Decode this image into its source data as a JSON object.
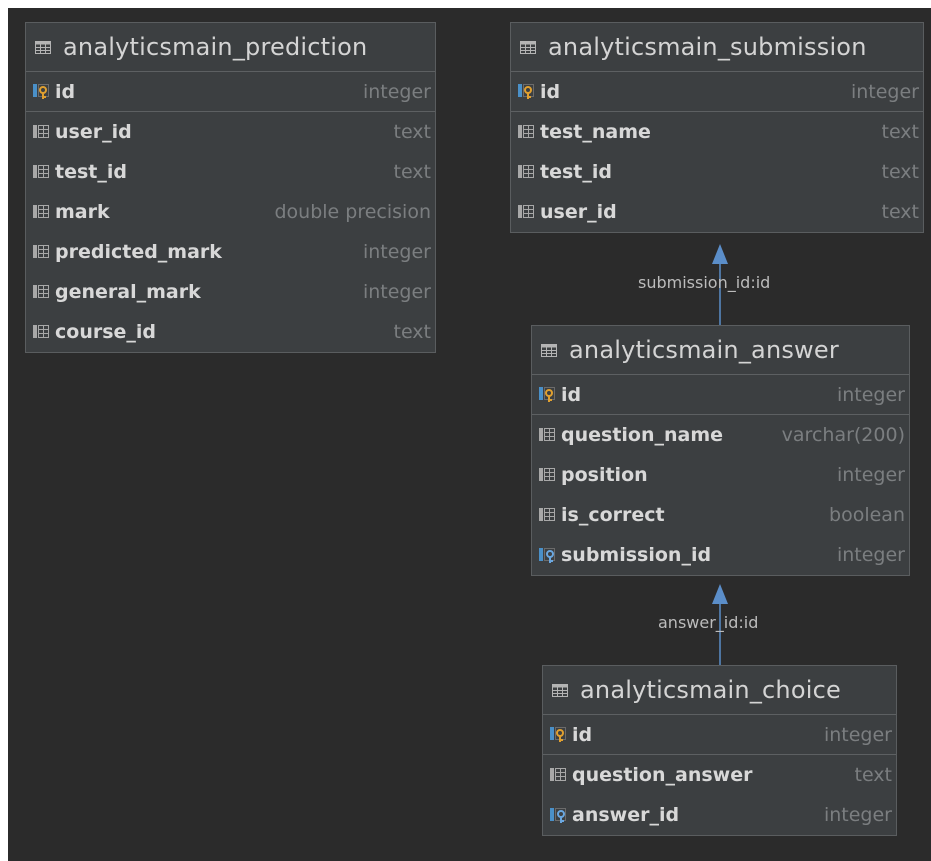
{
  "tables": [
    {
      "id": "prediction",
      "name": "analyticsmain_prediction",
      "columns": [
        {
          "name": "id",
          "type": "integer",
          "kind": "pk"
        },
        {
          "name": "user_id",
          "type": "text",
          "kind": "col"
        },
        {
          "name": "test_id",
          "type": "text",
          "kind": "col"
        },
        {
          "name": "mark",
          "type": "double precision",
          "kind": "col"
        },
        {
          "name": "predicted_mark",
          "type": "integer",
          "kind": "col"
        },
        {
          "name": "general_mark",
          "type": "integer",
          "kind": "col"
        },
        {
          "name": "course_id",
          "type": "text",
          "kind": "col"
        }
      ]
    },
    {
      "id": "submission",
      "name": "analyticsmain_submission",
      "columns": [
        {
          "name": "id",
          "type": "integer",
          "kind": "pk"
        },
        {
          "name": "test_name",
          "type": "text",
          "kind": "col"
        },
        {
          "name": "test_id",
          "type": "text",
          "kind": "col"
        },
        {
          "name": "user_id",
          "type": "text",
          "kind": "col"
        }
      ]
    },
    {
      "id": "answer",
      "name": "analyticsmain_answer",
      "columns": [
        {
          "name": "id",
          "type": "integer",
          "kind": "pk"
        },
        {
          "name": "question_name",
          "type": "varchar(200)",
          "kind": "col"
        },
        {
          "name": "position",
          "type": "integer",
          "kind": "col"
        },
        {
          "name": "is_correct",
          "type": "boolean",
          "kind": "col"
        },
        {
          "name": "submission_id",
          "type": "integer",
          "kind": "fk"
        }
      ]
    },
    {
      "id": "choice",
      "name": "analyticsmain_choice",
      "columns": [
        {
          "name": "id",
          "type": "integer",
          "kind": "pk"
        },
        {
          "name": "question_answer",
          "type": "text",
          "kind": "col"
        },
        {
          "name": "answer_id",
          "type": "integer",
          "kind": "fk"
        }
      ]
    }
  ],
  "relations": [
    {
      "label": "submission_id:id",
      "from": "answer",
      "to": "submission"
    },
    {
      "label": "answer_id:id",
      "from": "choice",
      "to": "answer"
    }
  ],
  "colors": {
    "canvas": "#2b2b2b",
    "table_bg": "#3c3f41",
    "edge": "#5b8ec9",
    "pk_key": "#e0a030",
    "fk_key": "#6aa7e0"
  }
}
